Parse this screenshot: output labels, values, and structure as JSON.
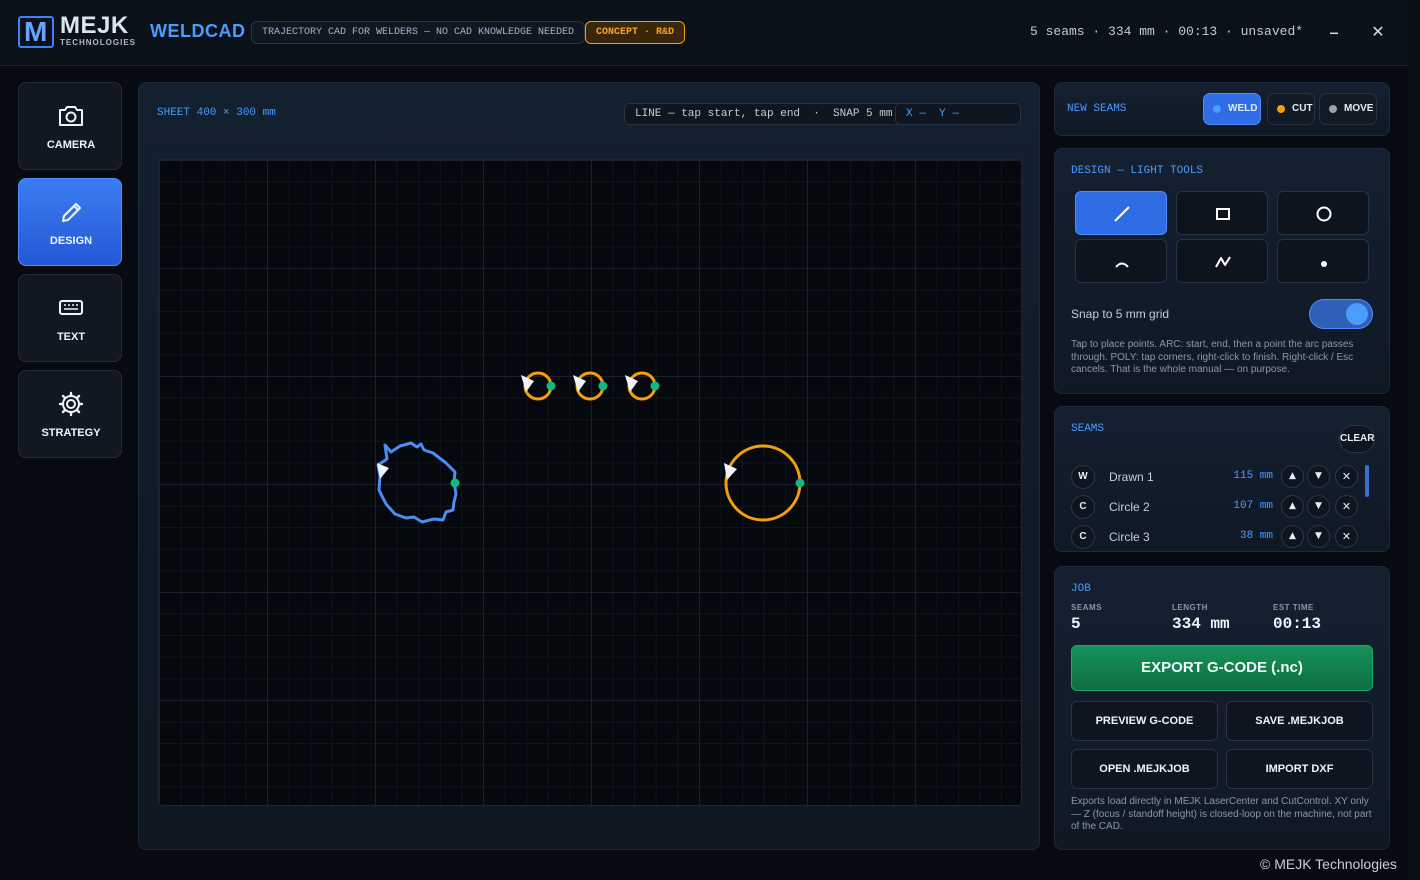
{
  "header": {
    "logo_letter": "M",
    "brand": "MEJK",
    "brand_sub": "TECHNOLOGIES",
    "app_name": "WELDCAD",
    "tagline": "TRAJECTORY CAD FOR WELDERS — NO CAD KNOWLEDGE NEEDED",
    "badge": "CONCEPT · R&D",
    "status": "5 seams · 334 mm · 00:13 · unsaved*",
    "minimize": "–",
    "close": "✕"
  },
  "sidebar": {
    "items": [
      {
        "label": "CAMERA",
        "icon": "camera-icon"
      },
      {
        "label": "DESIGN",
        "icon": "pencil-icon",
        "active": true
      },
      {
        "label": "TEXT",
        "icon": "keyboard-icon"
      },
      {
        "label": "STRATEGY",
        "icon": "gear-icon"
      }
    ]
  },
  "canvas": {
    "sheet": "SHEET 400 × 300 mm",
    "hint": "LINE — tap start, tap end  ·  SNAP 5 mm",
    "coords": "X —  Y —"
  },
  "modes": {
    "title": "NEW SEAMS",
    "items": [
      {
        "label": "WELD",
        "color": "#4a9cff",
        "active": true
      },
      {
        "label": "CUT",
        "color": "#f59e0b"
      },
      {
        "label": "MOVE",
        "color": "#9aa3ad"
      }
    ]
  },
  "design": {
    "title": "DESIGN — LIGHT TOOLS",
    "tools": [
      {
        "icon": "line-icon",
        "active": true
      },
      {
        "icon": "rectangle-icon"
      },
      {
        "icon": "circle-icon"
      },
      {
        "icon": "arc-icon"
      },
      {
        "icon": "polyline-icon"
      },
      {
        "icon": "point-icon"
      }
    ],
    "snap_label": "Snap to 5 mm grid",
    "snap_on": true,
    "help": "Tap to place points. ARC: start, end, then a point the arc passes through. POLY: tap corners, right-click to finish. Right-click / Esc cancels. That is the whole manual — on purpose."
  },
  "seams": {
    "title": "SEAMS",
    "clear": "CLEAR",
    "rows": [
      {
        "badge": "W",
        "name": "Drawn 1",
        "length": "115 mm"
      },
      {
        "badge": "C",
        "name": "Circle 2",
        "length": "107 mm"
      },
      {
        "badge": "C",
        "name": "Circle 3",
        "length": "38 mm"
      }
    ],
    "up": "▲",
    "down": "▼",
    "remove": "✕"
  },
  "job": {
    "title": "JOB",
    "seams_label": "SEAMS",
    "seams_value": "5",
    "length_label": "LENGTH",
    "length_value": "334 mm",
    "time_label": "EST TIME",
    "time_value": "00:13",
    "export": "EXPORT G-CODE (.nc)",
    "preview": "PREVIEW G-CODE",
    "save": "SAVE .MEJKJOB",
    "open": "OPEN .MEJKJOB",
    "import": "IMPORT DXF",
    "note": "Exports load directly in MEJK LaserCenter and CutControl. XY only — Z (focus / standoff height) is closed-loop on the machine, not part of the CAD."
  },
  "footer": "© MEJK Technologies",
  "colors": {
    "weld": "#4a9cff",
    "cut": "#f59e0b",
    "start_marker": "#10b981",
    "accent": "#3b82f6"
  }
}
